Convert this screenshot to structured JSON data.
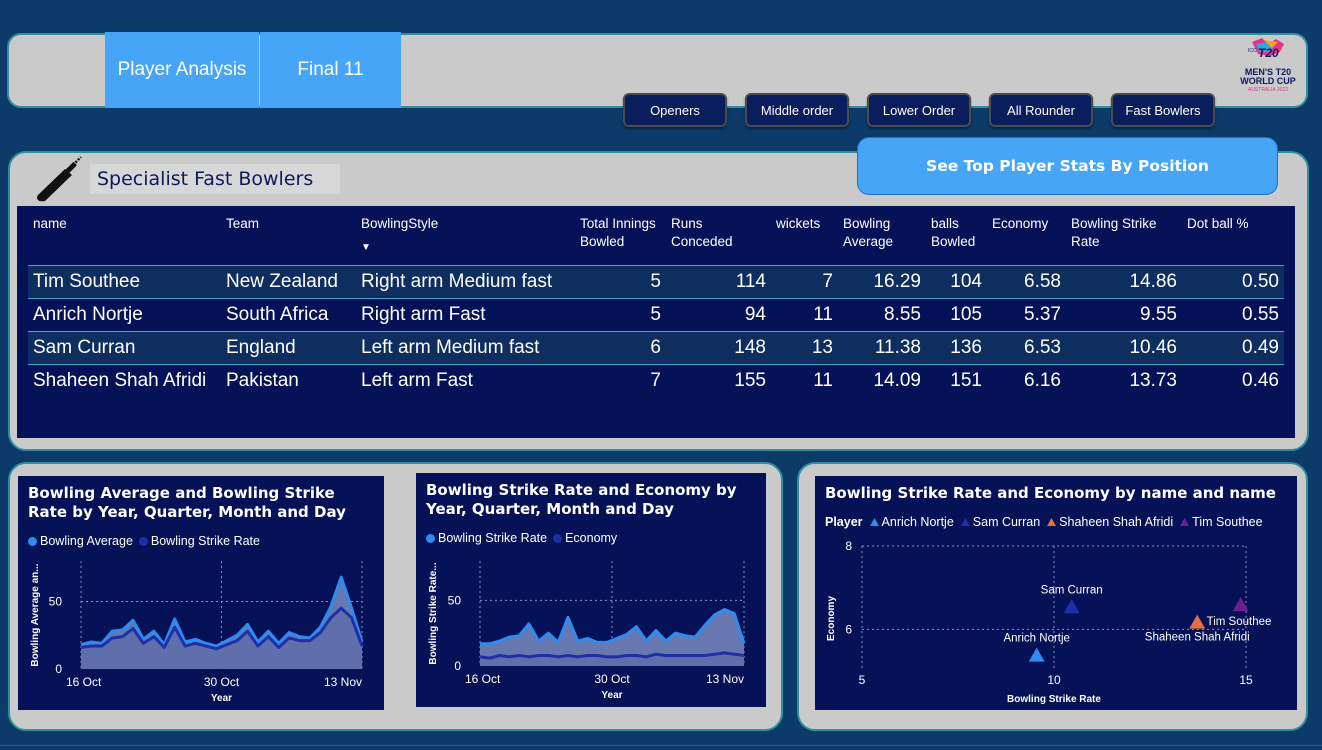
{
  "nav": {
    "tabs": [
      {
        "label": "Player Analysis"
      },
      {
        "label": "Final 11"
      }
    ],
    "position_buttons": [
      {
        "label": "Openers"
      },
      {
        "label": "Middle order"
      },
      {
        "label": "Lower Order"
      },
      {
        "label": "All Rounder"
      },
      {
        "label": "Fast Bowlers"
      }
    ],
    "logo": {
      "icc": "ICC",
      "t20": "T20",
      "line1": "MEN'S T20",
      "line2": "WORLD CUP",
      "line3": "AUSTRALIA 2022"
    }
  },
  "section": {
    "title": "Specialist Fast Bowlers",
    "stats_button": "See Top Player Stats By Position"
  },
  "table": {
    "columns": [
      "name",
      "Team",
      "BowlingStyle",
      "Total Innings Bowled",
      "Runs Conceded",
      "wickets",
      "Bowling Average",
      "balls Bowled",
      "Economy",
      "Bowling Strike Rate",
      "Dot ball %"
    ],
    "sort_indicator": "▼",
    "rows": [
      [
        "Tim Southee",
        "New Zealand",
        "Right arm Medium fast",
        "5",
        "114",
        "7",
        "16.29",
        "104",
        "6.58",
        "14.86",
        "0.50"
      ],
      [
        "Anrich Nortje",
        "South Africa",
        "Right arm Fast",
        "5",
        "94",
        "11",
        "8.55",
        "105",
        "5.37",
        "9.55",
        "0.55"
      ],
      [
        "Sam Curran",
        "England",
        "Left arm Medium fast",
        "6",
        "148",
        "13",
        "11.38",
        "136",
        "6.53",
        "10.46",
        "0.49"
      ],
      [
        "Shaheen Shah Afridi",
        "Pakistan",
        "Left arm Fast",
        "7",
        "155",
        "11",
        "14.09",
        "151",
        "6.16",
        "13.73",
        "0.46"
      ]
    ]
  },
  "colors": {
    "background": "#0d3b69",
    "panel": "#cacaca",
    "accent": "#47a5f7",
    "chart_bg": "#061258",
    "series_light": "#2e8cf0",
    "series_dark": "#1f2fa8",
    "area_fill": "#6d7eb5"
  },
  "chart_data": [
    {
      "type": "area",
      "title": "Bowling Average and Bowling Strike Rate by Year, Quarter, Month and Day",
      "xlabel": "Year",
      "ylabel": "Bowling Average an...",
      "x_ticks": [
        "16 Oct",
        "30 Oct",
        "13 Nov"
      ],
      "y_ticks": [
        "0",
        "50"
      ],
      "ylim": [
        0,
        80
      ],
      "grid": true,
      "legend_position": "top-left",
      "series": [
        {
          "name": "Bowling Average",
          "color": "#2e8cf0",
          "values": [
            18,
            20,
            19,
            28,
            29,
            36,
            22,
            28,
            18,
            37,
            20,
            22,
            19,
            17,
            21,
            25,
            33,
            20,
            28,
            19,
            27,
            24,
            23,
            31,
            46,
            68,
            45,
            20
          ]
        },
        {
          "name": "Bowling Strike Rate",
          "color": "#1f2fa8",
          "values": [
            16,
            17,
            17,
            23,
            24,
            30,
            19,
            24,
            16,
            31,
            17,
            19,
            17,
            15,
            18,
            21,
            28,
            17,
            24,
            16,
            23,
            21,
            21,
            27,
            38,
            45,
            38,
            17
          ]
        }
      ]
    },
    {
      "type": "area",
      "title": "Bowling Strike Rate and Economy by Year, Quarter, Month and Day",
      "xlabel": "Year",
      "ylabel": "Bowling Strike Rate...",
      "x_ticks": [
        "16 Oct",
        "30 Oct",
        "13 Nov"
      ],
      "y_ticks": [
        "0",
        "50"
      ],
      "ylim": [
        0,
        80
      ],
      "grid": true,
      "legend_position": "top-left",
      "series": [
        {
          "name": "Bowling Strike Rate",
          "color": "#2e8cf0",
          "values": [
            17,
            17,
            19,
            22,
            23,
            32,
            19,
            25,
            18,
            37,
            19,
            21,
            18,
            18,
            21,
            24,
            30,
            19,
            27,
            19,
            25,
            23,
            22,
            31,
            39,
            43,
            40,
            17
          ]
        },
        {
          "name": "Economy",
          "color": "#1f2fa8",
          "values": [
            7,
            6,
            8,
            7,
            8,
            7,
            8,
            8,
            7,
            8,
            7,
            8,
            8,
            7,
            7,
            8,
            8,
            7,
            9,
            8,
            8,
            8,
            8,
            8,
            9,
            10,
            9,
            8
          ]
        }
      ]
    },
    {
      "type": "scatter",
      "title": "Bowling Strike Rate and Economy by name and name",
      "xlabel": "Bowling Strike Rate",
      "ylabel": "Economy",
      "legend_title": "Player",
      "legend_position": "top-left",
      "xlim": [
        5,
        15
      ],
      "ylim": [
        5,
        8
      ],
      "x_ticks": [
        "5",
        "10",
        "15"
      ],
      "y_ticks": [
        "6",
        "8"
      ],
      "grid": true,
      "points": [
        {
          "name": "Anrich Nortje",
          "x": 9.55,
          "y": 5.37,
          "color": "#2e8cf0"
        },
        {
          "name": "Sam Curran",
          "x": 10.46,
          "y": 6.53,
          "color": "#1f2fa8"
        },
        {
          "name": "Shaheen Shah Afridi",
          "x": 13.73,
          "y": 6.16,
          "color": "#e07040"
        },
        {
          "name": "Tim Southee",
          "x": 14.86,
          "y": 6.58,
          "color": "#6b1f8a"
        }
      ]
    }
  ]
}
